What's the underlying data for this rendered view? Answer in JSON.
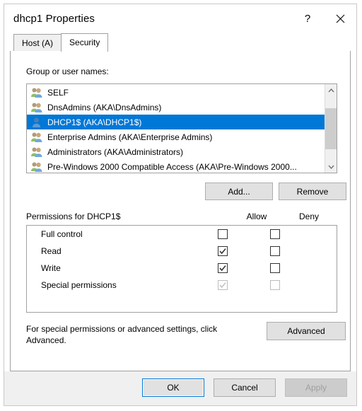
{
  "window": {
    "title": "dhcp1 Properties",
    "help_icon": "question-mark-icon",
    "close_icon": "close-icon"
  },
  "tabs": [
    {
      "label": "Host (A)",
      "active": false
    },
    {
      "label": "Security",
      "active": true
    }
  ],
  "security": {
    "group_label": "Group or user names:",
    "entries": [
      {
        "name": "SELF",
        "icon": "group-icon",
        "selected": false
      },
      {
        "name": "DnsAdmins (AKA\\DnsAdmins)",
        "icon": "group-icon",
        "selected": false
      },
      {
        "name": "DHCP1$ (AKA\\DHCP1$)",
        "icon": "user-icon",
        "selected": true
      },
      {
        "name": "Enterprise Admins (AKA\\Enterprise Admins)",
        "icon": "group-icon",
        "selected": false
      },
      {
        "name": "Administrators (AKA\\Administrators)",
        "icon": "group-icon",
        "selected": false
      },
      {
        "name": "Pre-Windows 2000 Compatible Access (AKA\\Pre-Windows 2000...",
        "icon": "group-icon",
        "selected": false
      }
    ],
    "scrollbar": {
      "up_arrow": "chevron-up-icon",
      "down_arrow": "chevron-down-icon"
    },
    "add_label": "Add...",
    "remove_label": "Remove",
    "permissions_title": "Permissions for DHCP1$",
    "allow_header": "Allow",
    "deny_header": "Deny",
    "permissions": [
      {
        "label": "Full control",
        "allow": false,
        "deny": false,
        "allow_disabled": false,
        "deny_disabled": false
      },
      {
        "label": "Read",
        "allow": true,
        "deny": false,
        "allow_disabled": false,
        "deny_disabled": false
      },
      {
        "label": "Write",
        "allow": true,
        "deny": false,
        "allow_disabled": false,
        "deny_disabled": false
      },
      {
        "label": "Special permissions",
        "allow": true,
        "deny": false,
        "allow_disabled": true,
        "deny_disabled": true
      }
    ],
    "advanced_text": "For special permissions or advanced settings, click Advanced.",
    "advanced_label": "Advanced"
  },
  "footer": {
    "ok_label": "OK",
    "cancel_label": "Cancel",
    "apply_label": "Apply",
    "apply_disabled": true
  },
  "colors": {
    "selection": "#0078d7",
    "dialog_bg": "#ffffff",
    "footer_bg": "#f0f0f0",
    "button_bg": "#e1e1e1",
    "disabled_text": "#a0a0a0"
  }
}
